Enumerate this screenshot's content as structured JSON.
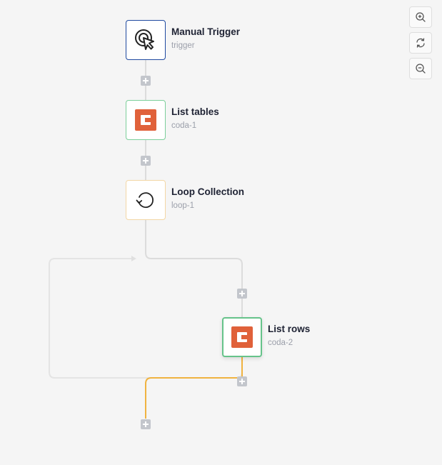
{
  "nodes": [
    {
      "id": "manual-trigger",
      "title": "Manual Trigger",
      "subtitle": "trigger",
      "icon": "cursor-click-icon"
    },
    {
      "id": "list-tables",
      "title": "List tables",
      "subtitle": "coda-1",
      "icon": "coda-logo-icon"
    },
    {
      "id": "loop-collection",
      "title": "Loop Collection",
      "subtitle": "loop-1",
      "icon": "loop-icon"
    },
    {
      "id": "list-rows",
      "title": "List rows",
      "subtitle": "coda-2",
      "icon": "coda-logo-icon"
    }
  ],
  "controls": [
    {
      "name": "zoom-in",
      "icon": "zoom-in-icon"
    },
    {
      "name": "reset-view",
      "icon": "refresh-icon"
    },
    {
      "name": "zoom-out",
      "icon": "zoom-out-icon"
    }
  ],
  "colors": {
    "background": "#f5f5f5",
    "trigger_border": "#1f4aa0",
    "coda_border": "#7ccf9a",
    "loop_border": "#f3d7a5",
    "selected_border": "#66c38a",
    "coda_brand": "#e0613a",
    "edge": "#dcdcdc",
    "active_edge": "#f0b340",
    "add_button": "#c3c6cc"
  }
}
